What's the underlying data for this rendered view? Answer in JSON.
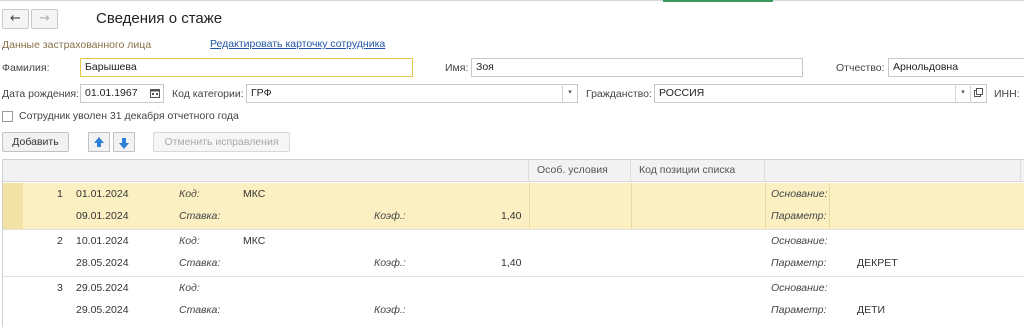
{
  "header": {
    "title": "Сведения о стаже",
    "back_icon": "arrow-left-icon",
    "forward_icon": "arrow-right-icon"
  },
  "section": {
    "label": "Данные застрахованного лица",
    "edit_link": "Редактировать карточку сотрудника"
  },
  "form": {
    "surname_label": "Фамилия:",
    "surname_value": "Барышева",
    "name_label": "Имя:",
    "name_value": "Зоя",
    "patronymic_label": "Отчество:",
    "patronymic_value": "Арнольдовна",
    "birthdate_label": "Дата рождения:",
    "birthdate_value": "01.01.1967",
    "category_label": "Код категории:",
    "category_value": "ГРФ",
    "citizenship_label": "Гражданство:",
    "citizenship_value": "РОССИЯ",
    "inn_label": "ИНН:",
    "dismissed_label": "Сотрудник уволен 31 декабря отчетного года",
    "dismissed_checked": false
  },
  "toolbar": {
    "add_label": "Добавить",
    "undo_label": "Отменить исправления"
  },
  "table": {
    "columns": [
      "Особ. условия",
      "Код позиции списка"
    ],
    "rows": [
      {
        "num": "1",
        "selected": true,
        "line1": {
          "date": "01.01.2024",
          "kind_label": "Код:",
          "kind_value": "МКС",
          "right_label": "Основание:",
          "right_value": ""
        },
        "line2": {
          "date": "09.01.2024",
          "kind_label": "Ставка:",
          "coef_label": "Коэф.:",
          "coef_value": "1,40",
          "right_label": "Параметр:",
          "right_value": ""
        }
      },
      {
        "num": "2",
        "selected": false,
        "line1": {
          "date": "10.01.2024",
          "kind_label": "Код:",
          "kind_value": "МКС",
          "right_label": "Основание:",
          "right_value": ""
        },
        "line2": {
          "date": "28.05.2024",
          "kind_label": "Ставка:",
          "coef_label": "Коэф.:",
          "coef_value": "1,40",
          "right_label": "Параметр:",
          "right_value": "ДЕКРЕТ"
        }
      },
      {
        "num": "3",
        "selected": false,
        "line1": {
          "date": "29.05.2024",
          "kind_label": "Код:",
          "kind_value": "",
          "right_label": "Основание:",
          "right_value": ""
        },
        "line2": {
          "date": "29.05.2024",
          "kind_label": "Ставка:",
          "coef_label": "Коэф.:",
          "coef_value": "",
          "right_label": "Параметр:",
          "right_value": "ДЕТИ"
        }
      }
    ]
  },
  "colors": {
    "selection": "#fbf0c2",
    "link": "#2255aa",
    "section": "#8a7048",
    "focus_border": "#e8c84a"
  }
}
